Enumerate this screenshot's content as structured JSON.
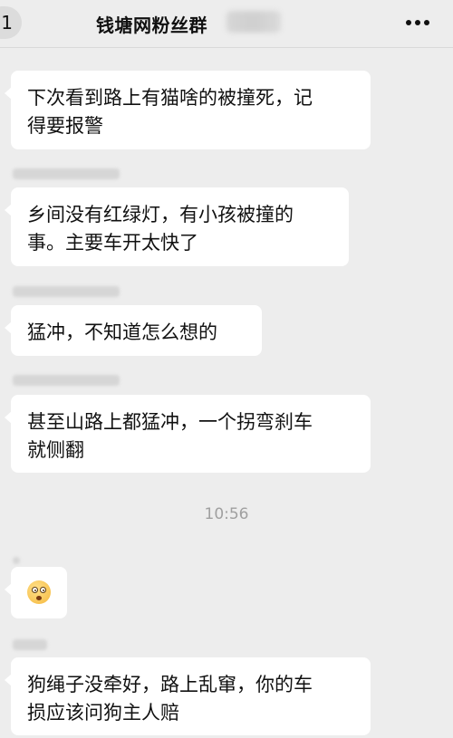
{
  "header": {
    "back_count": "1",
    "title": "钱塘网粉丝群"
  },
  "messages": [
    {
      "type": "text",
      "text": "下次看到路上有猫啥的被撞死，记\n得要报警"
    },
    {
      "type": "text",
      "text": "乡间没有红绿灯，有小孩被撞的\n事。主要车开太快了"
    },
    {
      "type": "text",
      "text": "猛冲，不知道怎么想的"
    },
    {
      "type": "text",
      "text": "甚至山路上都猛冲，一个拐弯刹车\n就侧翻"
    },
    {
      "type": "emoji",
      "icon": "shocked-face-emoji-icon"
    },
    {
      "type": "text",
      "text": "狗绳子没牵好，路上乱窜，你的车\n损应该问狗主人赔"
    }
  ],
  "timestamp": "10:56",
  "colors": {
    "background": "#ededed",
    "bubble": "#ffffff",
    "text": "#111111",
    "timestamp": "#a0a0a0"
  }
}
